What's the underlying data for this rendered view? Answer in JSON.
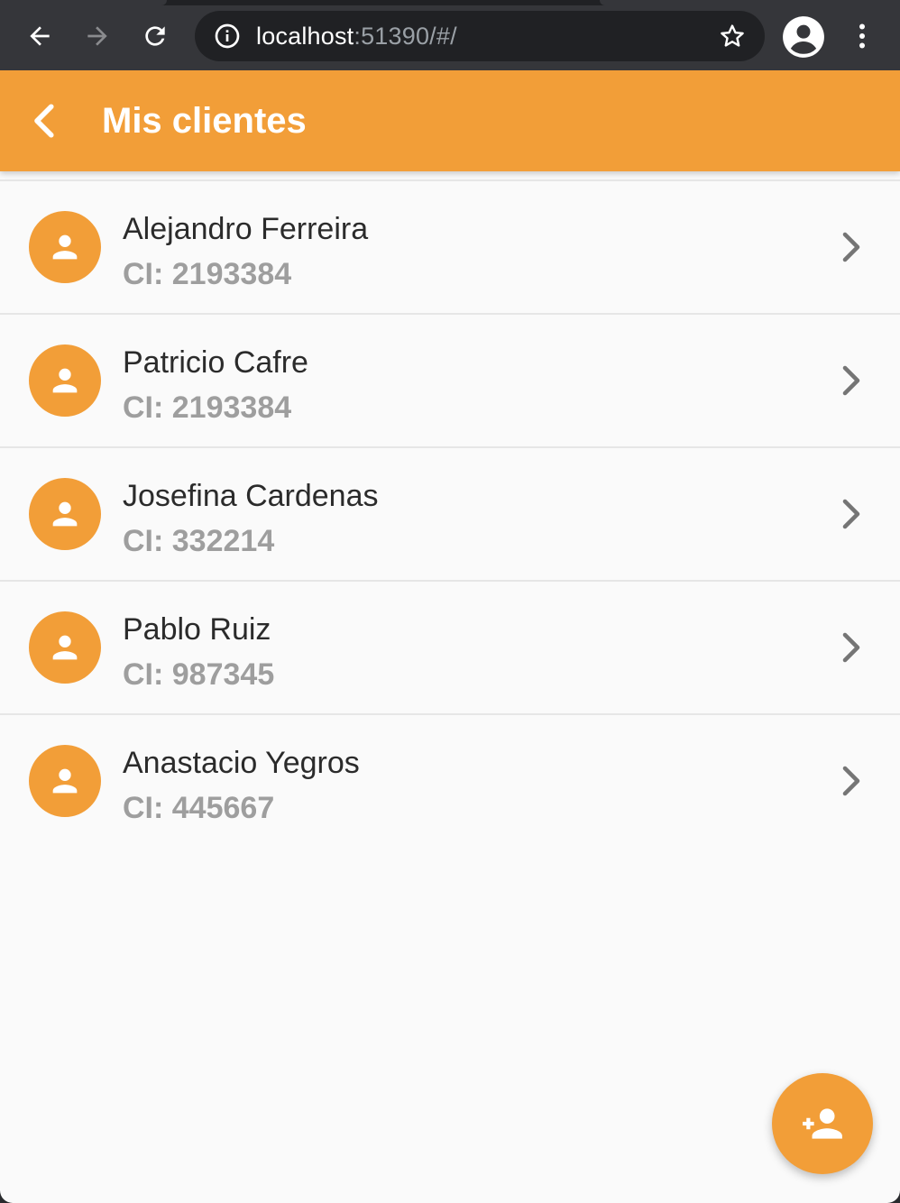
{
  "browser": {
    "url_host": "localhost",
    "url_rest": ":51390/#/",
    "icons": [
      "back-arrow-icon",
      "forward-arrow-icon",
      "reload-icon",
      "info-icon",
      "star-icon",
      "profile-icon",
      "more-vert-icon"
    ]
  },
  "appbar": {
    "title": "Mis clientes",
    "color": "#f29e38"
  },
  "clients": [
    {
      "name": "Alejandro Ferreira",
      "ci": "CI: 2193384"
    },
    {
      "name": "Patricio Cafre",
      "ci": "CI: 2193384"
    },
    {
      "name": "Josefina Cardenas",
      "ci": "CI: 332214"
    },
    {
      "name": "Pablo Ruiz",
      "ci": "CI: 987345"
    },
    {
      "name": "Anastacio Yegros",
      "ci": "CI: 445667"
    }
  ],
  "fab": {
    "icon": "person-add-icon"
  }
}
